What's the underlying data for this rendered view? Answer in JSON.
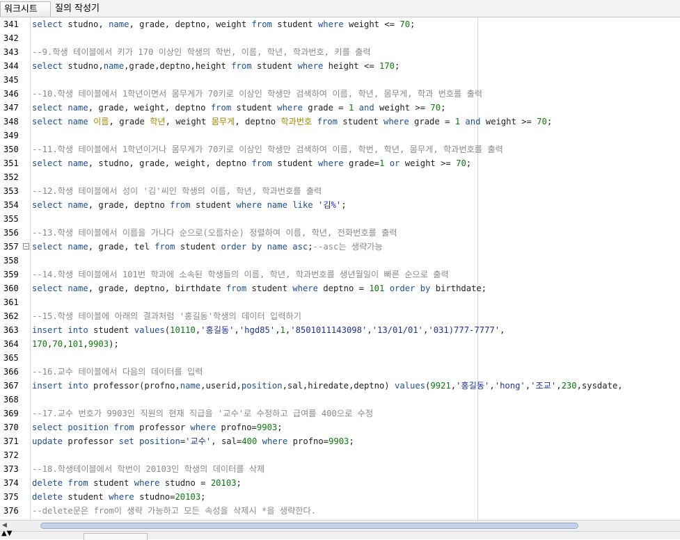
{
  "tabs": [
    {
      "label": "워크시트",
      "active": true
    },
    {
      "label": "질의 작성기",
      "active": false
    }
  ],
  "editor": {
    "lines": [
      {
        "n": "341",
        "tokens": [
          [
            "kw",
            "select"
          ],
          [
            "id",
            " studno, "
          ],
          [
            "kw",
            "name"
          ],
          [
            "id",
            ", grade, deptno, weight "
          ],
          [
            "kw",
            "from"
          ],
          [
            "id",
            " student "
          ],
          [
            "kw",
            "where"
          ],
          [
            "id",
            " weight <= "
          ],
          [
            "num",
            "70"
          ],
          [
            "id",
            ";"
          ]
        ]
      },
      {
        "n": "342",
        "tokens": []
      },
      {
        "n": "343",
        "tokens": [
          [
            "cm",
            "--9.학생 테이블에서 키가 170 이상인 학생의 학번, 이름, 학년, 학과번호, 키를 출력"
          ]
        ]
      },
      {
        "n": "344",
        "tokens": [
          [
            "kw",
            "select"
          ],
          [
            "id",
            " studno,"
          ],
          [
            "kw",
            "name"
          ],
          [
            "id",
            ",grade,deptno,height "
          ],
          [
            "kw",
            "from"
          ],
          [
            "id",
            " student "
          ],
          [
            "kw",
            "where"
          ],
          [
            "id",
            " height <= "
          ],
          [
            "num",
            "170"
          ],
          [
            "id",
            ";"
          ]
        ]
      },
      {
        "n": "345",
        "tokens": []
      },
      {
        "n": "346",
        "tokens": [
          [
            "cm",
            "--10.학생 테이블에서 1학년이면서 몸무게가 70키로 이상인 학생만 검색하여 이름, 학년, 몸무게, 학과 번호를 출력"
          ]
        ]
      },
      {
        "n": "347",
        "tokens": [
          [
            "kw",
            "select"
          ],
          [
            "id",
            " "
          ],
          [
            "kw",
            "name"
          ],
          [
            "id",
            ", grade, weight, deptno "
          ],
          [
            "kw",
            "from"
          ],
          [
            "id",
            " student "
          ],
          [
            "kw",
            "where"
          ],
          [
            "id",
            " grade = "
          ],
          [
            "num",
            "1"
          ],
          [
            "id",
            " "
          ],
          [
            "kw",
            "and"
          ],
          [
            "id",
            " weight >= "
          ],
          [
            "num",
            "70"
          ],
          [
            "id",
            ";"
          ]
        ]
      },
      {
        "n": "348",
        "tokens": [
          [
            "kw",
            "select"
          ],
          [
            "id",
            " "
          ],
          [
            "kw",
            "name"
          ],
          [
            "id",
            " "
          ],
          [
            "alias",
            "이름"
          ],
          [
            "id",
            ", grade "
          ],
          [
            "alias",
            "학년"
          ],
          [
            "id",
            ", weight "
          ],
          [
            "alias",
            "몸무게"
          ],
          [
            "id",
            ", deptno "
          ],
          [
            "alias",
            "학과번호"
          ],
          [
            "id",
            " "
          ],
          [
            "kw",
            "from"
          ],
          [
            "id",
            " student "
          ],
          [
            "kw",
            "where"
          ],
          [
            "id",
            " grade = "
          ],
          [
            "num",
            "1"
          ],
          [
            "id",
            " "
          ],
          [
            "kw",
            "and"
          ],
          [
            "id",
            " weight >= "
          ],
          [
            "num",
            "70"
          ],
          [
            "id",
            ";"
          ]
        ]
      },
      {
        "n": "349",
        "tokens": []
      },
      {
        "n": "350",
        "tokens": [
          [
            "cm",
            "--11.학생 테이블에서 1학년이거나 몸무게가 70키로 이상인 학생만 검색하여 이름, 학번, 학년, 몸무게, 학과번호를 출력"
          ]
        ]
      },
      {
        "n": "351",
        "tokens": [
          [
            "kw",
            "select"
          ],
          [
            "id",
            " "
          ],
          [
            "kw",
            "name"
          ],
          [
            "id",
            ", studno, grade, weight, deptno "
          ],
          [
            "kw",
            "from"
          ],
          [
            "id",
            " student "
          ],
          [
            "kw",
            "where"
          ],
          [
            "id",
            " grade="
          ],
          [
            "num",
            "1"
          ],
          [
            "id",
            " "
          ],
          [
            "kw",
            "or"
          ],
          [
            "id",
            " weight >= "
          ],
          [
            "num",
            "70"
          ],
          [
            "id",
            ";"
          ]
        ]
      },
      {
        "n": "352",
        "tokens": []
      },
      {
        "n": "353",
        "tokens": [
          [
            "cm",
            "--12.학생 테이블에서 성이 '김'씨인 학생의 이름, 학년, 학과번호를 출력"
          ]
        ]
      },
      {
        "n": "354",
        "tokens": [
          [
            "kw",
            "select"
          ],
          [
            "id",
            " "
          ],
          [
            "kw",
            "name"
          ],
          [
            "id",
            ", grade, deptno "
          ],
          [
            "kw",
            "from"
          ],
          [
            "id",
            " student "
          ],
          [
            "kw",
            "where"
          ],
          [
            "id",
            " "
          ],
          [
            "kw",
            "name"
          ],
          [
            "id",
            " "
          ],
          [
            "kw",
            "like"
          ],
          [
            "id",
            " "
          ],
          [
            "str",
            "'김%'"
          ],
          [
            "id",
            ";"
          ]
        ]
      },
      {
        "n": "355",
        "tokens": []
      },
      {
        "n": "356",
        "tokens": [
          [
            "cm",
            "--13.학생 테이블에서 이름을 가나다 순으로(오름차순) 정렬하여 이름, 학년, 전화번호를 출력"
          ]
        ]
      },
      {
        "n": "357",
        "fold": true,
        "tokens": [
          [
            "kw",
            "select"
          ],
          [
            "id",
            " "
          ],
          [
            "kw",
            "name"
          ],
          [
            "id",
            ", grade, tel "
          ],
          [
            "kw",
            "from"
          ],
          [
            "id",
            " student "
          ],
          [
            "kw",
            "order by"
          ],
          [
            "id",
            " "
          ],
          [
            "kw",
            "name"
          ],
          [
            "id",
            " "
          ],
          [
            "kw",
            "asc"
          ],
          [
            "id",
            ";"
          ],
          [
            "cm",
            "--asc는 생략가능"
          ]
        ]
      },
      {
        "n": "358",
        "tokens": []
      },
      {
        "n": "359",
        "tokens": [
          [
            "cm",
            "--14.학생 테이블에서 101번 학과에 소속된 학생들의 이름, 학년, 학과번호를 생년월일이 빠른 순으로 출력"
          ]
        ]
      },
      {
        "n": "360",
        "tokens": [
          [
            "kw",
            "select"
          ],
          [
            "id",
            " "
          ],
          [
            "kw",
            "name"
          ],
          [
            "id",
            ", grade, deptno, birthdate "
          ],
          [
            "kw",
            "from"
          ],
          [
            "id",
            " student "
          ],
          [
            "kw",
            "where"
          ],
          [
            "id",
            " deptno = "
          ],
          [
            "num",
            "101"
          ],
          [
            "id",
            " "
          ],
          [
            "kw",
            "order by"
          ],
          [
            "id",
            " birthdate;"
          ]
        ]
      },
      {
        "n": "361",
        "tokens": []
      },
      {
        "n": "362",
        "tokens": [
          [
            "cm",
            "--15.학생 테이블에 아래의 결과처럼 '홍길동'학생의 데이터 입력하기"
          ]
        ]
      },
      {
        "n": "363",
        "tokens": [
          [
            "kw",
            "insert into"
          ],
          [
            "id",
            " student "
          ],
          [
            "kw",
            "values"
          ],
          [
            "id",
            "("
          ],
          [
            "num",
            "10110"
          ],
          [
            "id",
            ","
          ],
          [
            "str",
            "'홍길동'"
          ],
          [
            "id",
            ","
          ],
          [
            "str",
            "'hgd85'"
          ],
          [
            "id",
            ","
          ],
          [
            "num",
            "1"
          ],
          [
            "id",
            ","
          ],
          [
            "str",
            "'8501011143098'"
          ],
          [
            "id",
            ","
          ],
          [
            "str",
            "'13/01/01'"
          ],
          [
            "id",
            ","
          ],
          [
            "str",
            "'031)777-7777'"
          ],
          [
            "id",
            ","
          ]
        ]
      },
      {
        "n": "364",
        "tokens": [
          [
            "num",
            "170"
          ],
          [
            "id",
            ","
          ],
          [
            "num",
            "70"
          ],
          [
            "id",
            ","
          ],
          [
            "num",
            "101"
          ],
          [
            "id",
            ","
          ],
          [
            "num",
            "9903"
          ],
          [
            "id",
            ");"
          ]
        ]
      },
      {
        "n": "365",
        "tokens": []
      },
      {
        "n": "366",
        "tokens": [
          [
            "cm",
            "--16.교수 테이블에서 다음의 데이터를 입력"
          ]
        ]
      },
      {
        "n": "367",
        "tokens": [
          [
            "kw",
            "insert into"
          ],
          [
            "id",
            " professor(profno,"
          ],
          [
            "kw",
            "name"
          ],
          [
            "id",
            ",userid,"
          ],
          [
            "kw",
            "position"
          ],
          [
            "id",
            ",sal,hiredate,deptno) "
          ],
          [
            "kw",
            "values"
          ],
          [
            "id",
            "("
          ],
          [
            "num",
            "9921"
          ],
          [
            "id",
            ","
          ],
          [
            "str",
            "'홍길동'"
          ],
          [
            "id",
            ","
          ],
          [
            "str",
            "'hong'"
          ],
          [
            "id",
            ","
          ],
          [
            "str",
            "'조교'"
          ],
          [
            "id",
            ","
          ],
          [
            "num",
            "230"
          ],
          [
            "id",
            ",sysdate,"
          ]
        ]
      },
      {
        "n": "368",
        "tokens": []
      },
      {
        "n": "369",
        "tokens": [
          [
            "cm",
            "--17.교수 번호가 9903인 직원의 현재 직급을 '교수'로 수정하고 급여를 400으로 수정"
          ]
        ]
      },
      {
        "n": "370",
        "tokens": [
          [
            "kw",
            "select"
          ],
          [
            "id",
            " "
          ],
          [
            "kw",
            "position"
          ],
          [
            "id",
            " "
          ],
          [
            "kw",
            "from"
          ],
          [
            "id",
            " professor "
          ],
          [
            "kw",
            "where"
          ],
          [
            "id",
            " profno="
          ],
          [
            "num",
            "9903"
          ],
          [
            "id",
            ";"
          ]
        ]
      },
      {
        "n": "371",
        "tokens": [
          [
            "kw",
            "update"
          ],
          [
            "id",
            " professor "
          ],
          [
            "kw",
            "set"
          ],
          [
            "id",
            " "
          ],
          [
            "kw",
            "position"
          ],
          [
            "id",
            "="
          ],
          [
            "str",
            "'교수'"
          ],
          [
            "id",
            ", sal="
          ],
          [
            "num",
            "400"
          ],
          [
            "id",
            " "
          ],
          [
            "kw",
            "where"
          ],
          [
            "id",
            " profno="
          ],
          [
            "num",
            "9903"
          ],
          [
            "id",
            ";"
          ]
        ]
      },
      {
        "n": "372",
        "tokens": []
      },
      {
        "n": "373",
        "tokens": [
          [
            "cm",
            "--18.학생테이블에서 학번이 20103인 학생의 데이터를 삭제"
          ]
        ]
      },
      {
        "n": "374",
        "tokens": [
          [
            "kw",
            "delete"
          ],
          [
            "id",
            " "
          ],
          [
            "kw",
            "from"
          ],
          [
            "id",
            " student "
          ],
          [
            "kw",
            "where"
          ],
          [
            "id",
            " studno = "
          ],
          [
            "num",
            "20103"
          ],
          [
            "id",
            ";"
          ]
        ]
      },
      {
        "n": "375",
        "tokens": [
          [
            "kw",
            "delete"
          ],
          [
            "id",
            " student "
          ],
          [
            "kw",
            "where"
          ],
          [
            "id",
            " studno="
          ],
          [
            "num",
            "20103"
          ],
          [
            "id",
            ";"
          ]
        ]
      },
      {
        "n": "376",
        "tokens": [
          [
            "cm",
            "--delete문은 from이 생략 가능하고 모든 속성을 삭제시 *을 생략한다."
          ]
        ]
      }
    ]
  },
  "colors": {
    "keyword": "#1d4e9a",
    "number": "#0a7a0a",
    "string": "#1f2fa6",
    "comment": "#8a8a8a",
    "alias": "#a08a00"
  }
}
